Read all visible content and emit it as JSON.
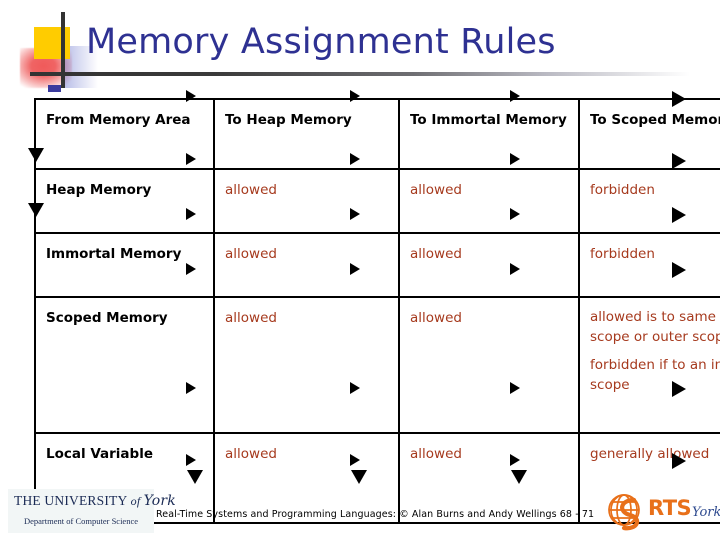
{
  "slide": {
    "title": "Memory Assignment Rules"
  },
  "table": {
    "headers": [
      "From Memory Area",
      "To Heap Memory",
      "To Immortal Memory",
      "To Scoped Memory"
    ],
    "rows": [
      {
        "label": "Heap Memory",
        "to_heap": "allowed",
        "to_immortal": "allowed",
        "to_scoped": [
          "forbidden"
        ]
      },
      {
        "label": "Immortal Memory",
        "to_heap": "allowed",
        "to_immortal": "allowed",
        "to_scoped": [
          "forbidden"
        ]
      },
      {
        "label": "Scoped Memory",
        "to_heap": "allowed",
        "to_immortal": "allowed",
        "to_scoped": [
          "allowed is to same scope or outer scope",
          "forbidden if to an inner scope"
        ]
      },
      {
        "label": "Local Variable",
        "to_heap": "allowed",
        "to_immortal": "allowed",
        "to_scoped": [
          "generally allowed"
        ]
      }
    ]
  },
  "footer": {
    "note": "Real-Time Systems and Programming Languages: © Alan Burns and Andy Wellings 68 - 71",
    "york_logo": {
      "the": "THE ",
      "university": "UNIVERSITY",
      "of": " of ",
      "york": "York",
      "department": "Department of Computer Science"
    },
    "rts_logo": {
      "rts": "RTS",
      "york": "York"
    }
  },
  "colors": {
    "title": "#2E3192",
    "value_text": "#A63A1E",
    "header_text": "#000000",
    "deco_yellow": "#FFCC00",
    "deco_red": "#F05A5A",
    "deco_blue": "#3B3B9E",
    "rts_orange": "#E8701A",
    "rts_blue": "#2E4A8F"
  }
}
